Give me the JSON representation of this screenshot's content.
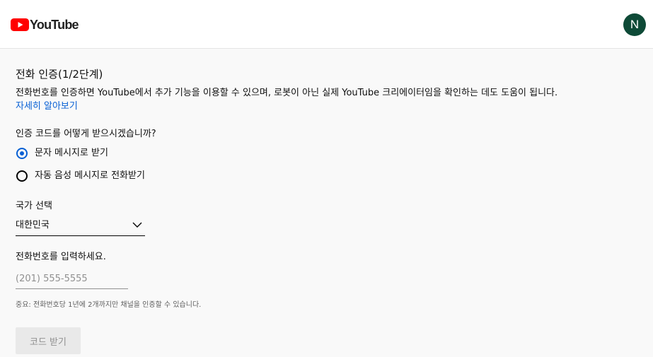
{
  "header": {
    "logo_text": "YouTube",
    "avatar_initial": "N",
    "avatar_color": "#0e4a37",
    "logo_icon": "youtube-play-icon",
    "logo_color": "#ff0000"
  },
  "main": {
    "title": "전화 인증(1/2단계)",
    "description": "전화번호를 인증하면 YouTube에서 추가 기능을 이용할 수 있으며, 로봇이 아닌 실제 YouTube 크리에이터임을 확인하는 데도 도움이 됩니다.",
    "learn_more": "자세히 알아보기",
    "question": "인증 코드를 어떻게 받으시겠습니까?",
    "options": [
      {
        "label": "문자 메시지로 받기",
        "checked": true
      },
      {
        "label": "자동 음성 메시지로 전화받기",
        "checked": false
      }
    ],
    "country": {
      "label": "국가 선택",
      "value": "대한민국",
      "icon": "chevron-down-icon"
    },
    "phone": {
      "label": "전화번호를 입력하세요.",
      "placeholder": "(201) 555-5555",
      "value": ""
    },
    "note": "중요: 전화번호당 1년에 2개까지만 채널을 인증할 수 있습니다.",
    "submit_label": "코드 받기",
    "accent_color": "#065fd4"
  }
}
